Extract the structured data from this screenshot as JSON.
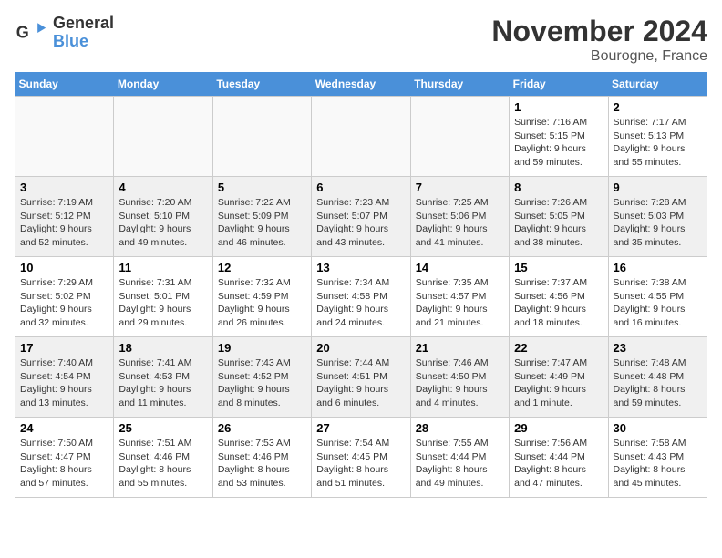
{
  "logo": {
    "line1": "General",
    "line2": "Blue"
  },
  "title": "November 2024",
  "location": "Bourogne, France",
  "headers": [
    "Sunday",
    "Monday",
    "Tuesday",
    "Wednesday",
    "Thursday",
    "Friday",
    "Saturday"
  ],
  "weeks": [
    [
      {
        "day": "",
        "info": ""
      },
      {
        "day": "",
        "info": ""
      },
      {
        "day": "",
        "info": ""
      },
      {
        "day": "",
        "info": ""
      },
      {
        "day": "",
        "info": ""
      },
      {
        "day": "1",
        "info": "Sunrise: 7:16 AM\nSunset: 5:15 PM\nDaylight: 9 hours and 59 minutes."
      },
      {
        "day": "2",
        "info": "Sunrise: 7:17 AM\nSunset: 5:13 PM\nDaylight: 9 hours and 55 minutes."
      }
    ],
    [
      {
        "day": "3",
        "info": "Sunrise: 7:19 AM\nSunset: 5:12 PM\nDaylight: 9 hours and 52 minutes."
      },
      {
        "day": "4",
        "info": "Sunrise: 7:20 AM\nSunset: 5:10 PM\nDaylight: 9 hours and 49 minutes."
      },
      {
        "day": "5",
        "info": "Sunrise: 7:22 AM\nSunset: 5:09 PM\nDaylight: 9 hours and 46 minutes."
      },
      {
        "day": "6",
        "info": "Sunrise: 7:23 AM\nSunset: 5:07 PM\nDaylight: 9 hours and 43 minutes."
      },
      {
        "day": "7",
        "info": "Sunrise: 7:25 AM\nSunset: 5:06 PM\nDaylight: 9 hours and 41 minutes."
      },
      {
        "day": "8",
        "info": "Sunrise: 7:26 AM\nSunset: 5:05 PM\nDaylight: 9 hours and 38 minutes."
      },
      {
        "day": "9",
        "info": "Sunrise: 7:28 AM\nSunset: 5:03 PM\nDaylight: 9 hours and 35 minutes."
      }
    ],
    [
      {
        "day": "10",
        "info": "Sunrise: 7:29 AM\nSunset: 5:02 PM\nDaylight: 9 hours and 32 minutes."
      },
      {
        "day": "11",
        "info": "Sunrise: 7:31 AM\nSunset: 5:01 PM\nDaylight: 9 hours and 29 minutes."
      },
      {
        "day": "12",
        "info": "Sunrise: 7:32 AM\nSunset: 4:59 PM\nDaylight: 9 hours and 26 minutes."
      },
      {
        "day": "13",
        "info": "Sunrise: 7:34 AM\nSunset: 4:58 PM\nDaylight: 9 hours and 24 minutes."
      },
      {
        "day": "14",
        "info": "Sunrise: 7:35 AM\nSunset: 4:57 PM\nDaylight: 9 hours and 21 minutes."
      },
      {
        "day": "15",
        "info": "Sunrise: 7:37 AM\nSunset: 4:56 PM\nDaylight: 9 hours and 18 minutes."
      },
      {
        "day": "16",
        "info": "Sunrise: 7:38 AM\nSunset: 4:55 PM\nDaylight: 9 hours and 16 minutes."
      }
    ],
    [
      {
        "day": "17",
        "info": "Sunrise: 7:40 AM\nSunset: 4:54 PM\nDaylight: 9 hours and 13 minutes."
      },
      {
        "day": "18",
        "info": "Sunrise: 7:41 AM\nSunset: 4:53 PM\nDaylight: 9 hours and 11 minutes."
      },
      {
        "day": "19",
        "info": "Sunrise: 7:43 AM\nSunset: 4:52 PM\nDaylight: 9 hours and 8 minutes."
      },
      {
        "day": "20",
        "info": "Sunrise: 7:44 AM\nSunset: 4:51 PM\nDaylight: 9 hours and 6 minutes."
      },
      {
        "day": "21",
        "info": "Sunrise: 7:46 AM\nSunset: 4:50 PM\nDaylight: 9 hours and 4 minutes."
      },
      {
        "day": "22",
        "info": "Sunrise: 7:47 AM\nSunset: 4:49 PM\nDaylight: 9 hours and 1 minute."
      },
      {
        "day": "23",
        "info": "Sunrise: 7:48 AM\nSunset: 4:48 PM\nDaylight: 8 hours and 59 minutes."
      }
    ],
    [
      {
        "day": "24",
        "info": "Sunrise: 7:50 AM\nSunset: 4:47 PM\nDaylight: 8 hours and 57 minutes."
      },
      {
        "day": "25",
        "info": "Sunrise: 7:51 AM\nSunset: 4:46 PM\nDaylight: 8 hours and 55 minutes."
      },
      {
        "day": "26",
        "info": "Sunrise: 7:53 AM\nSunset: 4:46 PM\nDaylight: 8 hours and 53 minutes."
      },
      {
        "day": "27",
        "info": "Sunrise: 7:54 AM\nSunset: 4:45 PM\nDaylight: 8 hours and 51 minutes."
      },
      {
        "day": "28",
        "info": "Sunrise: 7:55 AM\nSunset: 4:44 PM\nDaylight: 8 hours and 49 minutes."
      },
      {
        "day": "29",
        "info": "Sunrise: 7:56 AM\nSunset: 4:44 PM\nDaylight: 8 hours and 47 minutes."
      },
      {
        "day": "30",
        "info": "Sunrise: 7:58 AM\nSunset: 4:43 PM\nDaylight: 8 hours and 45 minutes."
      }
    ]
  ]
}
